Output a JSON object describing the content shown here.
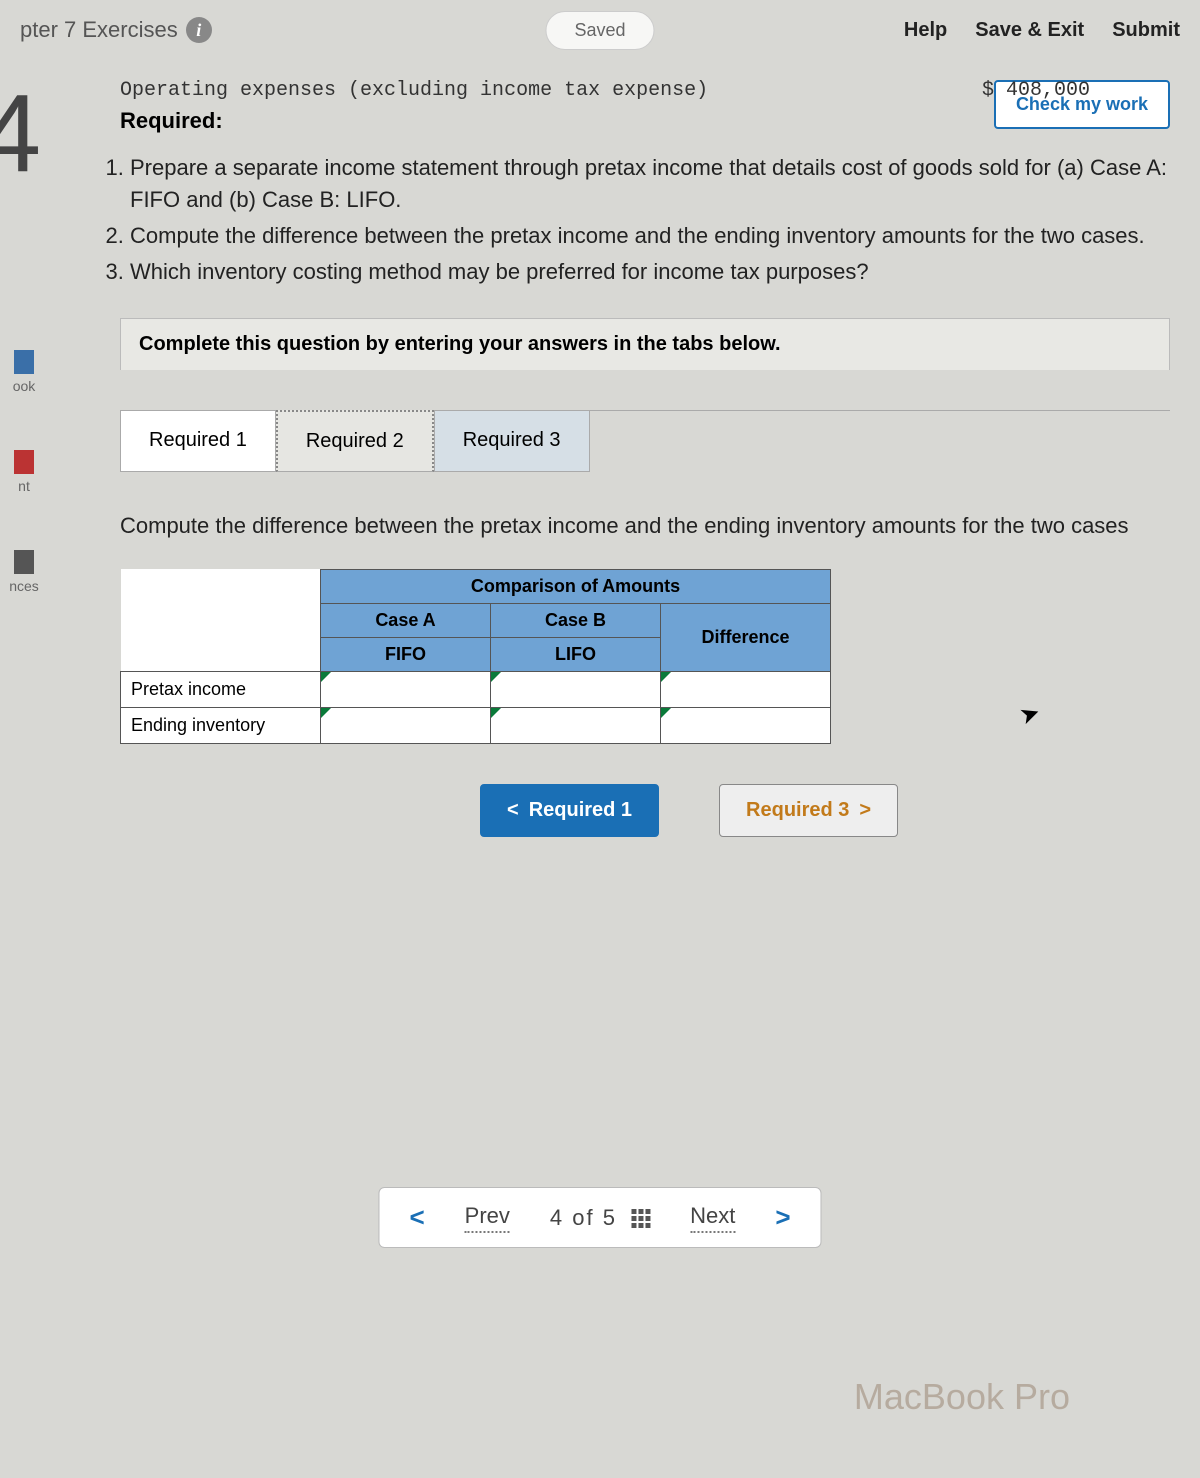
{
  "header": {
    "title": "pter 7 Exercises",
    "saved": "Saved",
    "help": "Help",
    "save_exit": "Save & Exit",
    "submit": "Submit",
    "check_work": "Check my work"
  },
  "question_number": "4",
  "sidebar": {
    "items": [
      "ook",
      "nt",
      "nces"
    ]
  },
  "problem": {
    "opex_label": "Operating expenses (excluding income tax expense)",
    "opex_value": "$ 408,000",
    "required_label": "Required:",
    "req1": "Prepare a separate income statement through pretax income that details cost of goods sold for (a) Case A: FIFO and (b) Case B: LIFO.",
    "req2": "Compute the difference between the pretax income and the ending inventory amounts for the two cases.",
    "req3": "Which inventory costing method may be preferred for income tax purposes?"
  },
  "instruction": "Complete this question by entering your answers in the tabs below.",
  "tabs": {
    "t1": "Required 1",
    "t2": "Required 2",
    "t3": "Required 3"
  },
  "tab_desc": "Compute the difference between the pretax income and the ending inventory amounts for the two cases",
  "table": {
    "title": "Comparison of Amounts",
    "colA_top": "Case A",
    "colA_sub": "FIFO",
    "colB_top": "Case B",
    "colB_sub": "LIFO",
    "colDiff": "Difference",
    "row1": "Pretax income",
    "row2": "Ending inventory"
  },
  "nav": {
    "prev_tab": "Required 1",
    "next_tab": "Required 3"
  },
  "pager": {
    "prev": "Prev",
    "count": "4 of 5",
    "next": "Next"
  },
  "device": "MacBook Pro"
}
